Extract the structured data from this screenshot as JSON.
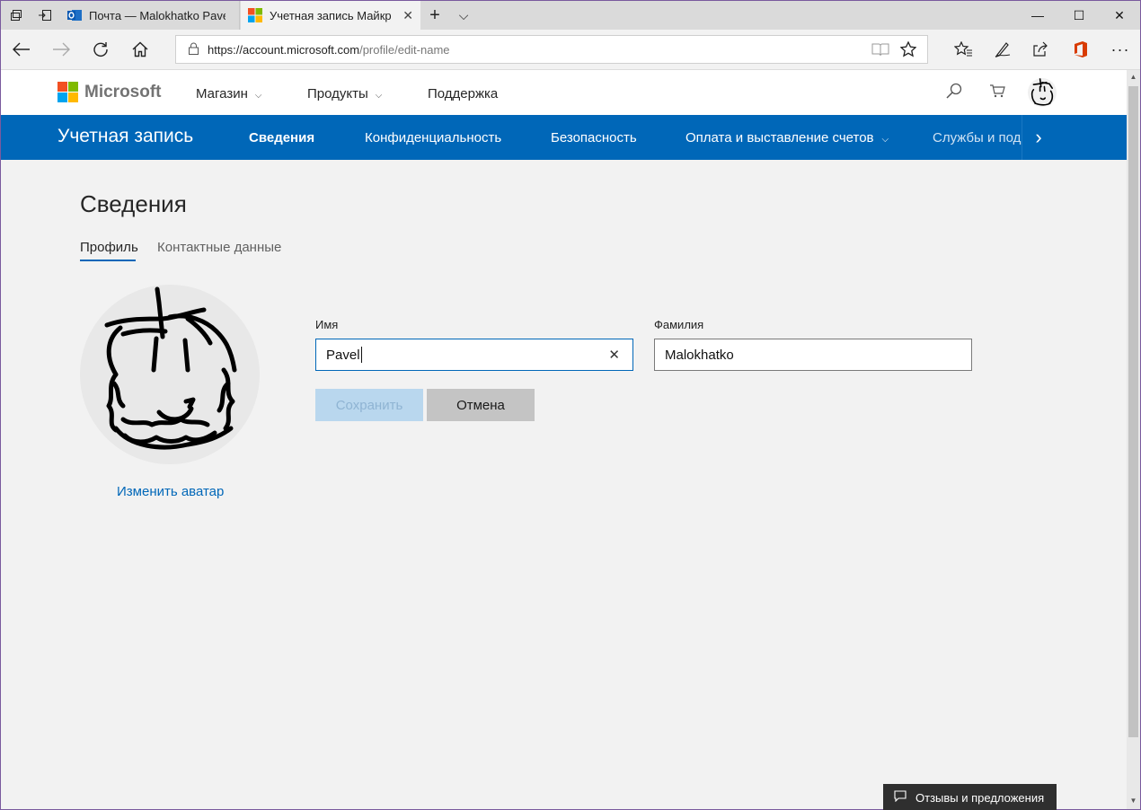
{
  "browser": {
    "tabs": [
      {
        "label": "Почта — Malokhatko Pavel",
        "active": false
      },
      {
        "label": "Учетная запись Майкр",
        "active": true
      }
    ],
    "url_host": "https://account.microsoft.com",
    "url_path": "/profile/edit-name",
    "lock_glyph": "🔒",
    "window_controls": {
      "minimize": "—",
      "maximize": "☐",
      "close": "✕"
    },
    "tab_close": "✕",
    "new_tab": "+",
    "tab_menu": "⌵"
  },
  "site_header": {
    "brand": "Microsoft",
    "nav": [
      {
        "label": "Магазин",
        "dropdown": true
      },
      {
        "label": "Продукты",
        "dropdown": true
      },
      {
        "label": "Поддержка",
        "dropdown": false
      }
    ],
    "chevron": "⌵"
  },
  "account_nav": {
    "title": "Учетная запись",
    "items": [
      {
        "label": "Сведения",
        "active": true
      },
      {
        "label": "Конфиденциальность"
      },
      {
        "label": "Безопасность"
      },
      {
        "label": "Оплата и выставление счетов",
        "dropdown": true
      },
      {
        "label": "Службы и под"
      }
    ],
    "next_glyph": "›"
  },
  "main": {
    "title": "Сведения",
    "tabs": [
      {
        "label": "Профиль",
        "active": true
      },
      {
        "label": "Контактные данные"
      }
    ],
    "change_avatar": "Изменить аватар",
    "first_name": {
      "label": "Имя",
      "value": "Pavel",
      "clear": "✕"
    },
    "last_name": {
      "label": "Фамилия",
      "value": "Malokhatko"
    },
    "save_label": "Сохранить",
    "cancel_label": "Отмена"
  },
  "feedback_label": "Отзывы и предложения",
  "colors": {
    "accent": "#0067b8",
    "logo": [
      "#f25022",
      "#7fba00",
      "#00a4ef",
      "#ffb900"
    ]
  }
}
